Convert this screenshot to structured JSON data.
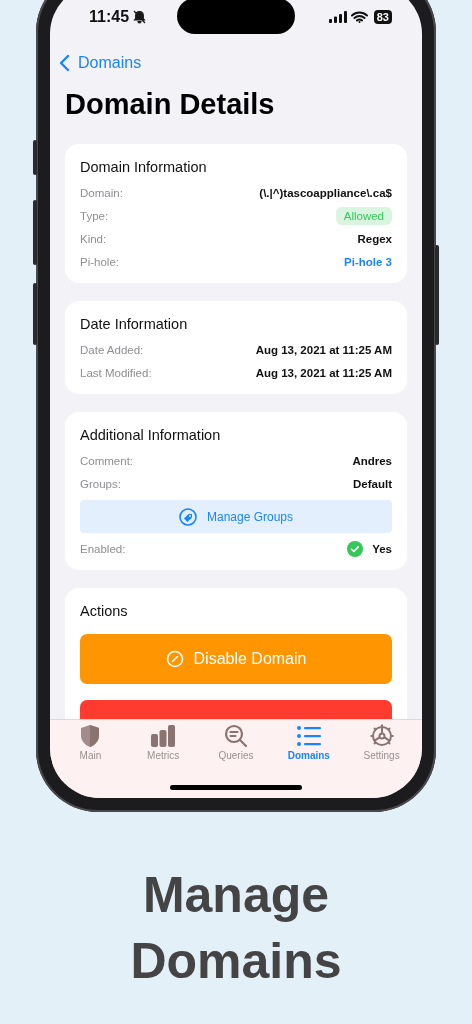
{
  "status_bar": {
    "time": "11:45",
    "battery": "83"
  },
  "nav": {
    "back_label": "Domains"
  },
  "title": "Domain Details",
  "sections": [
    {
      "title": "Domain Information",
      "items": [
        {
          "kind": "text",
          "label": "Domain:",
          "value": "(\\.|^)tascoappliance\\.ca$"
        },
        {
          "kind": "badge",
          "label": "Type:",
          "value": "Allowed"
        },
        {
          "kind": "text",
          "label": "Kind:",
          "value": "Regex"
        },
        {
          "kind": "link",
          "label": "Pi-hole:",
          "value": "Pi-hole 3"
        }
      ]
    },
    {
      "title": "Date Information",
      "items": [
        {
          "kind": "text",
          "label": "Date Added:",
          "value": "Aug 13, 2021 at 11:25 AM"
        },
        {
          "kind": "text",
          "label": "Last Modified:",
          "value": "Aug 13, 2021 at 11:25 AM"
        }
      ]
    },
    {
      "title": "Additional Information",
      "items": [
        {
          "kind": "text",
          "label": "Comment:",
          "value": "Andres"
        },
        {
          "kind": "text",
          "label": "Groups:",
          "value": "Default"
        },
        {
          "kind": "manage",
          "label": "Manage Groups"
        },
        {
          "kind": "check",
          "label": "Enabled:",
          "value": "Yes"
        }
      ]
    },
    {
      "title": "Actions",
      "items": [
        {
          "kind": "disable",
          "label": "Disable Domain",
          "color": "#ff9500"
        },
        {
          "kind": "remove",
          "color": "#ff3b30"
        }
      ]
    }
  ],
  "tabs": [
    {
      "label": "Main",
      "selected": false
    },
    {
      "label": "Metrics",
      "selected": false
    },
    {
      "label": "Queries",
      "selected": false
    },
    {
      "label": "Domains",
      "selected": true
    },
    {
      "label": "Settings",
      "selected": false
    }
  ],
  "caption": "Manage Domains"
}
